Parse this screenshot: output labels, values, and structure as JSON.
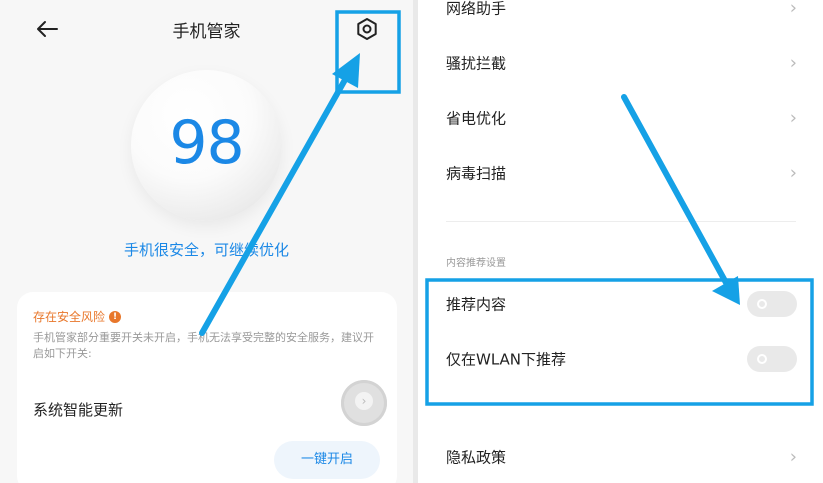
{
  "left": {
    "title": "手机管家",
    "score": "98",
    "status": "手机很安全，可继续优化",
    "card": {
      "risk_title": "存在安全风险",
      "risk_icon": "!",
      "description": "手机管家部分重要开关未开启，手机无法享受完整的安全服务，建议开启如下开关:",
      "item_label": "系统智能更新",
      "button_label": "一键开启"
    },
    "icons": [
      "back-arrow-icon",
      "settings-hexagon-icon",
      "chevron-right-icon"
    ]
  },
  "right": {
    "menu_top": [
      {
        "label": "网络助手"
      },
      {
        "label": "骚扰拦截"
      },
      {
        "label": "省电优化"
      },
      {
        "label": "病毒扫描"
      }
    ],
    "section_title": "内容推荐设置",
    "toggles": [
      {
        "label": "推荐内容",
        "on": false
      },
      {
        "label": "仅在WLAN下推荐",
        "on": false
      }
    ],
    "menu_bottom": [
      {
        "label": "隐私政策"
      }
    ],
    "chevron": "›"
  },
  "colors": {
    "accent": "#1b88e6",
    "warning": "#e8772b",
    "annotation": "#15a1e6"
  }
}
